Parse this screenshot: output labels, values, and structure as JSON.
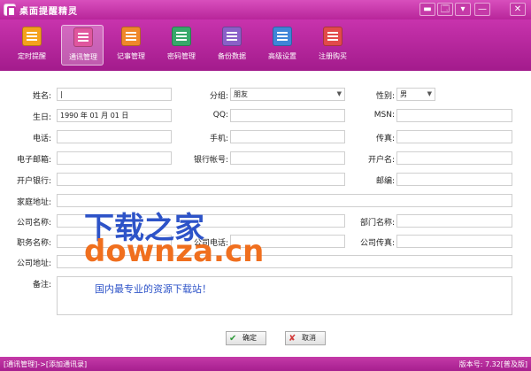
{
  "window": {
    "title": "桌面提醒精灵",
    "controls": [
      "▬",
      "🗔",
      "▾",
      "—",
      "✕"
    ]
  },
  "toolbar": {
    "items": [
      {
        "label": "定时提醒",
        "color": "#f4a21c"
      },
      {
        "label": "通讯管理",
        "color": "#e0569e",
        "active": true
      },
      {
        "label": "记事管理",
        "color": "#f0882a"
      },
      {
        "label": "密码管理",
        "color": "#37a86a"
      },
      {
        "label": "备份数据",
        "color": "#8a60c8"
      },
      {
        "label": "高级设置",
        "color": "#3e86d8"
      },
      {
        "label": "注册购买",
        "color": "#e24a4a"
      }
    ]
  },
  "form": {
    "name_label": "姓名:",
    "name_value": "|",
    "group_label": "分组:",
    "group_value": "朋友",
    "gender_label": "性别:",
    "gender_value": "男",
    "birthday_label": "生日:",
    "birthday_value": "1990  年  01  月  01  日",
    "qq_label": "QQ:",
    "msn_label": "MSN:",
    "phone_label": "电话:",
    "mobile_label": "手机:",
    "fax_label": "传真:",
    "email_label": "电子邮箱:",
    "bank_account_label": "银行帐号:",
    "account_name_label": "开户名:",
    "bank_label": "开户银行:",
    "postcode_label": "邮编:",
    "home_address_label": "家庭地址:",
    "company_label": "公司名称:",
    "department_label": "部门名称:",
    "position_label": "职务名称:",
    "company_phone_label": "公司电话:",
    "company_fax_label": "公司传真:",
    "company_address_label": "公司地址:",
    "notes_label": "备注:"
  },
  "buttons": {
    "ok": "确定",
    "cancel": "取消"
  },
  "watermark": {
    "line1": "下载之家",
    "line2": "downza.cn",
    "line3": "国内最专业的资源下载站！"
  },
  "status": {
    "left": "[通讯管理]->[添加通讯录]",
    "right": "版本号: 7.32[普及版]"
  }
}
